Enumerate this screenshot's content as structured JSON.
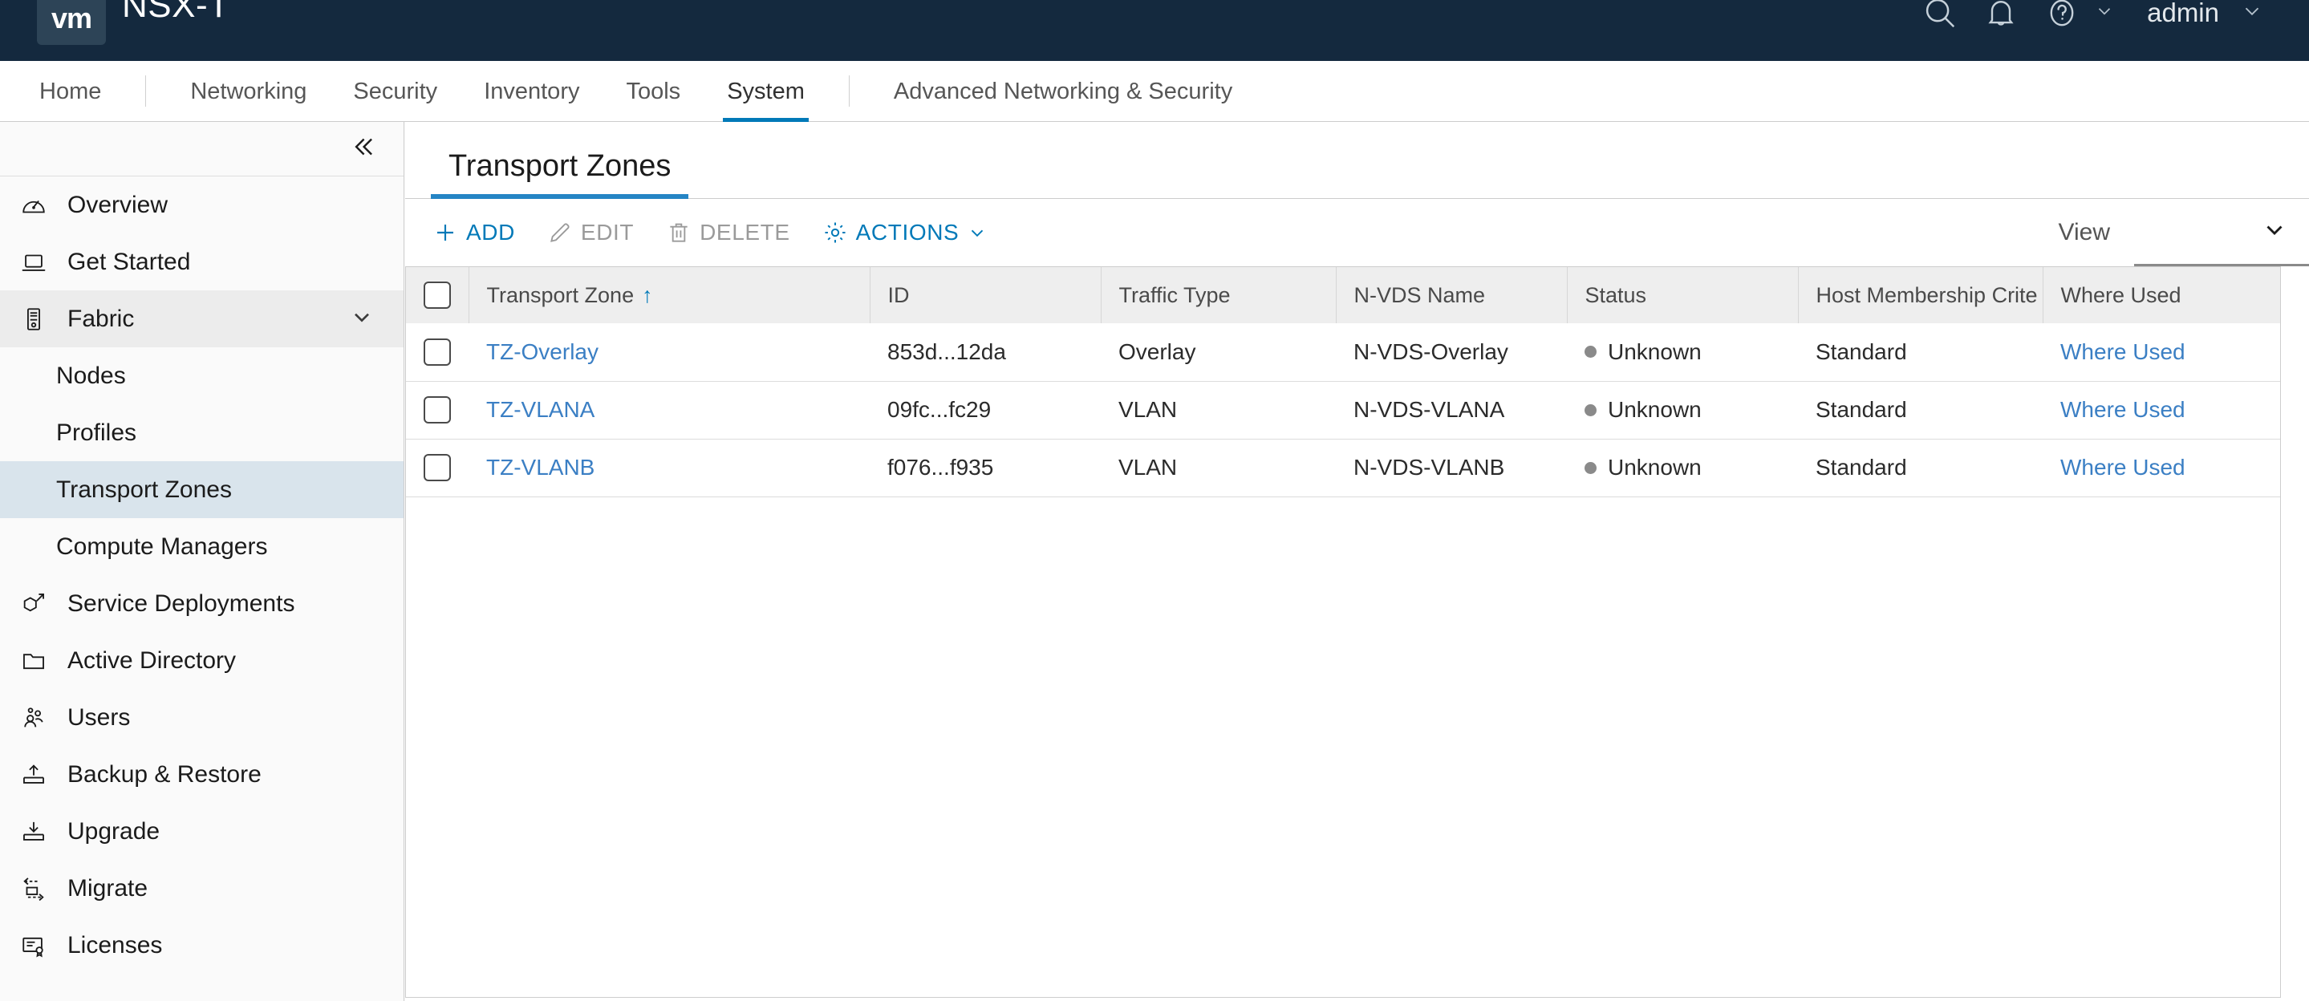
{
  "header": {
    "logo_text": "vm",
    "app_title": "NSX-T",
    "search_icon": "search-icon",
    "alarm_icon": "bell-icon",
    "help_icon": "help-circle-icon",
    "user_name": "admin"
  },
  "nav": {
    "items": [
      {
        "label": "Home",
        "active": false
      },
      {
        "label": "Networking",
        "active": false
      },
      {
        "label": "Security",
        "active": false
      },
      {
        "label": "Inventory",
        "active": false
      },
      {
        "label": "Tools",
        "active": false
      },
      {
        "label": "System",
        "active": true
      }
    ],
    "extra": {
      "label": "Advanced Networking & Security"
    }
  },
  "sidebar": {
    "collapse_icon": "double-chevron-left-icon",
    "items": [
      {
        "label": "Overview",
        "icon": "dashboard-icon"
      },
      {
        "label": "Get Started",
        "icon": "laptop-icon"
      },
      {
        "label": "Fabric",
        "icon": "server-rack-icon",
        "expanded": true
      },
      {
        "label": "Service Deployments",
        "icon": "deploy-cube-icon"
      },
      {
        "label": "Active Directory",
        "icon": "folder-icon"
      },
      {
        "label": "Users",
        "icon": "users-group-icon"
      },
      {
        "label": "Backup & Restore",
        "icon": "backup-upload-icon"
      },
      {
        "label": "Upgrade",
        "icon": "upgrade-download-icon"
      },
      {
        "label": "Migrate",
        "icon": "migrate-arrows-icon"
      },
      {
        "label": "Licenses",
        "icon": "license-certificate-icon"
      }
    ],
    "fabric_children": [
      {
        "label": "Nodes",
        "selected": false
      },
      {
        "label": "Profiles",
        "selected": false
      },
      {
        "label": "Transport Zones",
        "selected": true
      },
      {
        "label": "Compute Managers",
        "selected": false
      }
    ]
  },
  "main": {
    "tab_label": "Transport Zones",
    "toolbar": {
      "add_label": "ADD",
      "edit_label": "EDIT",
      "delete_label": "DELETE",
      "actions_label": "ACTIONS",
      "add_icon": "plus-icon",
      "edit_icon": "pencil-icon",
      "delete_icon": "trash-icon",
      "actions_icon": "gear-icon",
      "actions_chevron": "chevron-down-icon"
    },
    "view": {
      "label": "View",
      "selected": "",
      "chevron": "chevron-down-icon"
    },
    "table": {
      "columns": [
        "Transport Zone",
        "ID",
        "Traffic Type",
        "N-VDS Name",
        "Status",
        "Host Membership Crite",
        "Where Used"
      ],
      "sort_column": "Transport Zone",
      "sort_direction": "ascending",
      "sort_glyph": "↑",
      "rows": [
        {
          "name": "TZ-Overlay",
          "id": "853d...12da",
          "traffic_type": "Overlay",
          "nvds_name": "N-VDS-Overlay",
          "status": "Unknown",
          "host_membership": "Standard",
          "where_used": "Where Used"
        },
        {
          "name": "TZ-VLANA",
          "id": "09fc...fc29",
          "traffic_type": "VLAN",
          "nvds_name": "N-VDS-VLANA",
          "status": "Unknown",
          "host_membership": "Standard",
          "where_used": "Where Used"
        },
        {
          "name": "TZ-VLANB",
          "id": "f076...f935",
          "traffic_type": "VLAN",
          "nvds_name": "N-VDS-VLANB",
          "status": "Unknown",
          "host_membership": "Standard",
          "where_used": "Where Used"
        }
      ]
    }
  },
  "colors": {
    "header_bg": "#14293e",
    "accent_blue": "#0079b8",
    "tab_underline": "#2585c5",
    "link_blue": "#3b7fc4",
    "selected_nav_bg": "#d9e4ec",
    "status_unknown": "#8a8a8a"
  }
}
